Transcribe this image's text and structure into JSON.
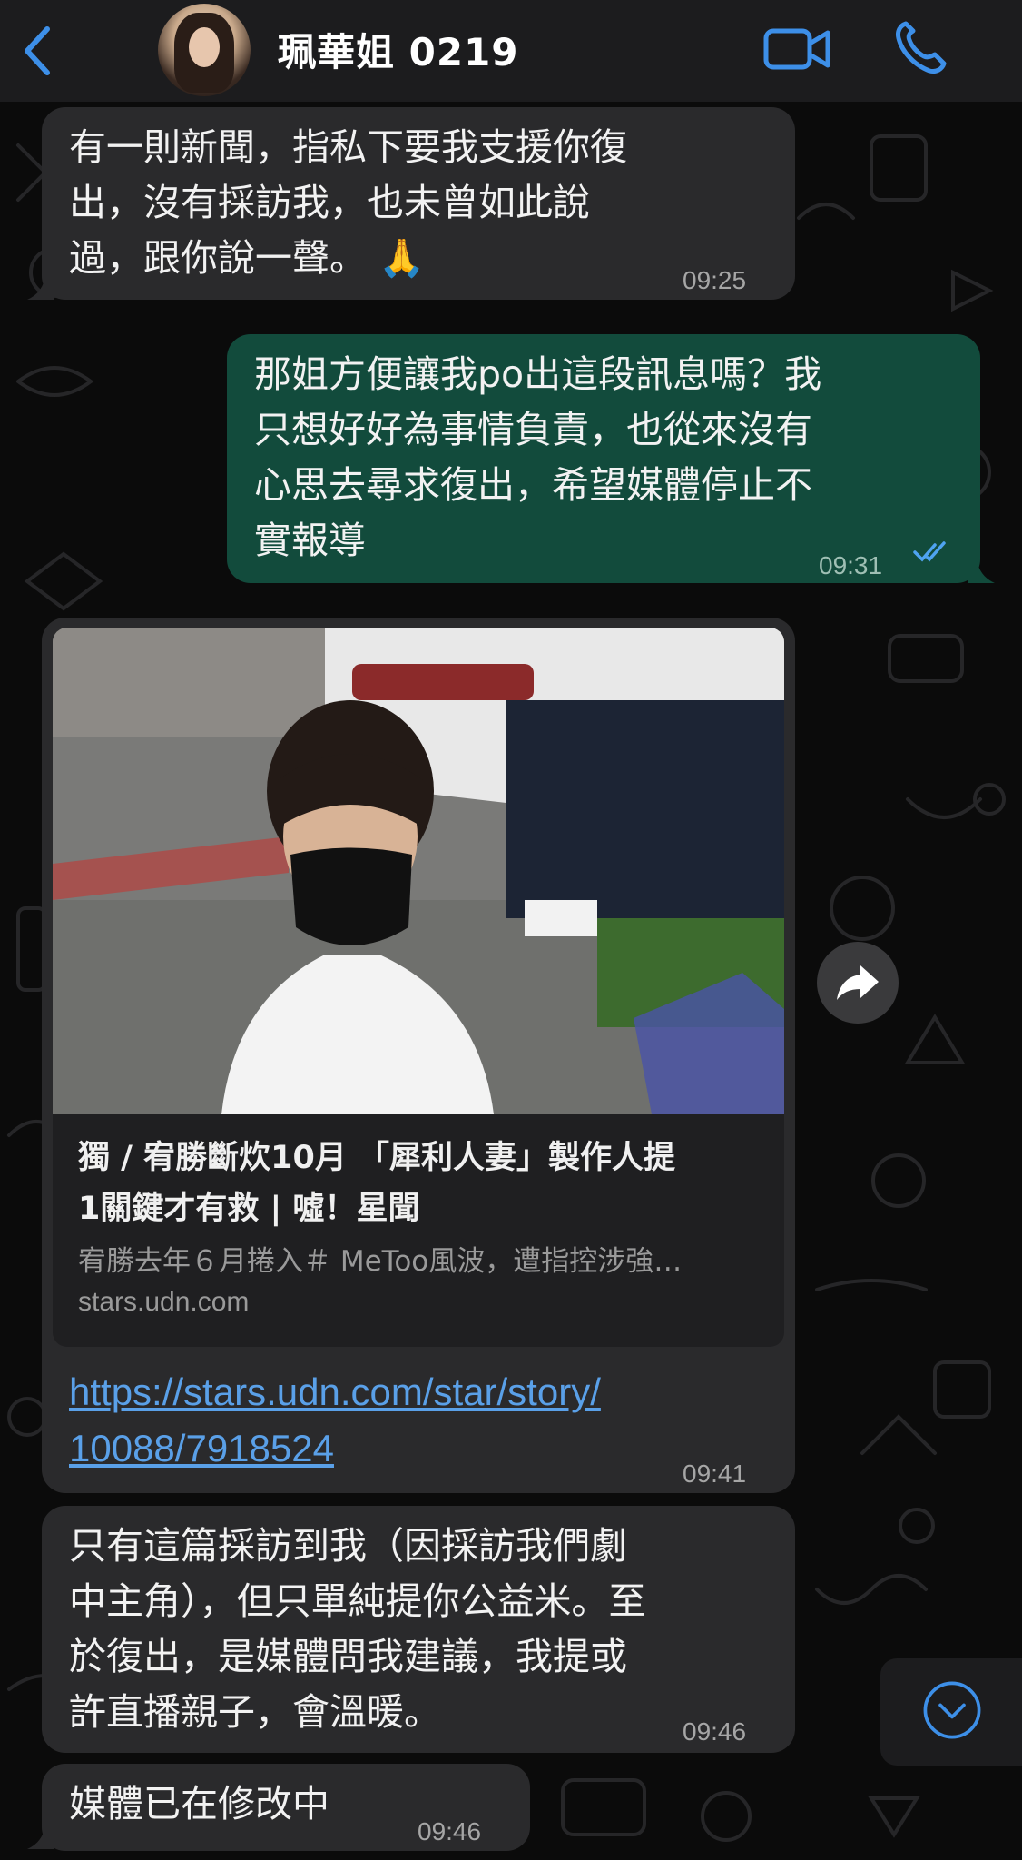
{
  "header": {
    "back_label": "back",
    "contact_name": "珮華姐 0219",
    "icons": [
      "chevron-left-icon",
      "video-camera-icon",
      "phone-icon"
    ],
    "accent_color": "#3d8fe8"
  },
  "messages": [
    {
      "direction": "incoming",
      "text": "有一則新聞，指私下要我支援你復\n出，沒有採訪我，也未曾如此說\n過，跟你說一聲。 🙏",
      "time": "09:25"
    },
    {
      "direction": "outgoing",
      "text": "那姐方便讓我po出這段訊息嗎？我\n只想好好為事情負責，也從來沒有\n心思去尋求復出，希望媒體停止不\n實報導",
      "time": "09:31",
      "status": "read"
    },
    {
      "direction": "incoming",
      "type": "link",
      "preview": {
        "title": "獨 / 宥勝斷炊10月 「犀利人妻」製作人提\n1關鍵才有救 | 噓！星聞",
        "description": "宥勝去年６月捲入＃ MeToo風波，遭指控涉強…",
        "domain": "stars.udn.com"
      },
      "url": "https://stars.udn.com/star/story/\n10088/7918524",
      "time": "09:41"
    },
    {
      "direction": "incoming",
      "text": "只有這篇採訪到我（因採訪我們劇\n中主角），但只單純提你公益米。至\n於復出，是媒體問我建議，我提或\n許直播親子，會溫暖。",
      "time": "09:46"
    },
    {
      "direction": "incoming",
      "text": "媒體已在修改中",
      "time": "09:46"
    }
  ],
  "controls": {
    "forward_icon": "forward-arrow-icon",
    "scroll_down_icon": "chevron-down-circle-icon"
  },
  "colors": {
    "incoming_bubble": "#2a2a2c",
    "outgoing_bubble": "#124b3c",
    "link": "#5aa0e8",
    "read_ticks": "#4fa3f0"
  }
}
